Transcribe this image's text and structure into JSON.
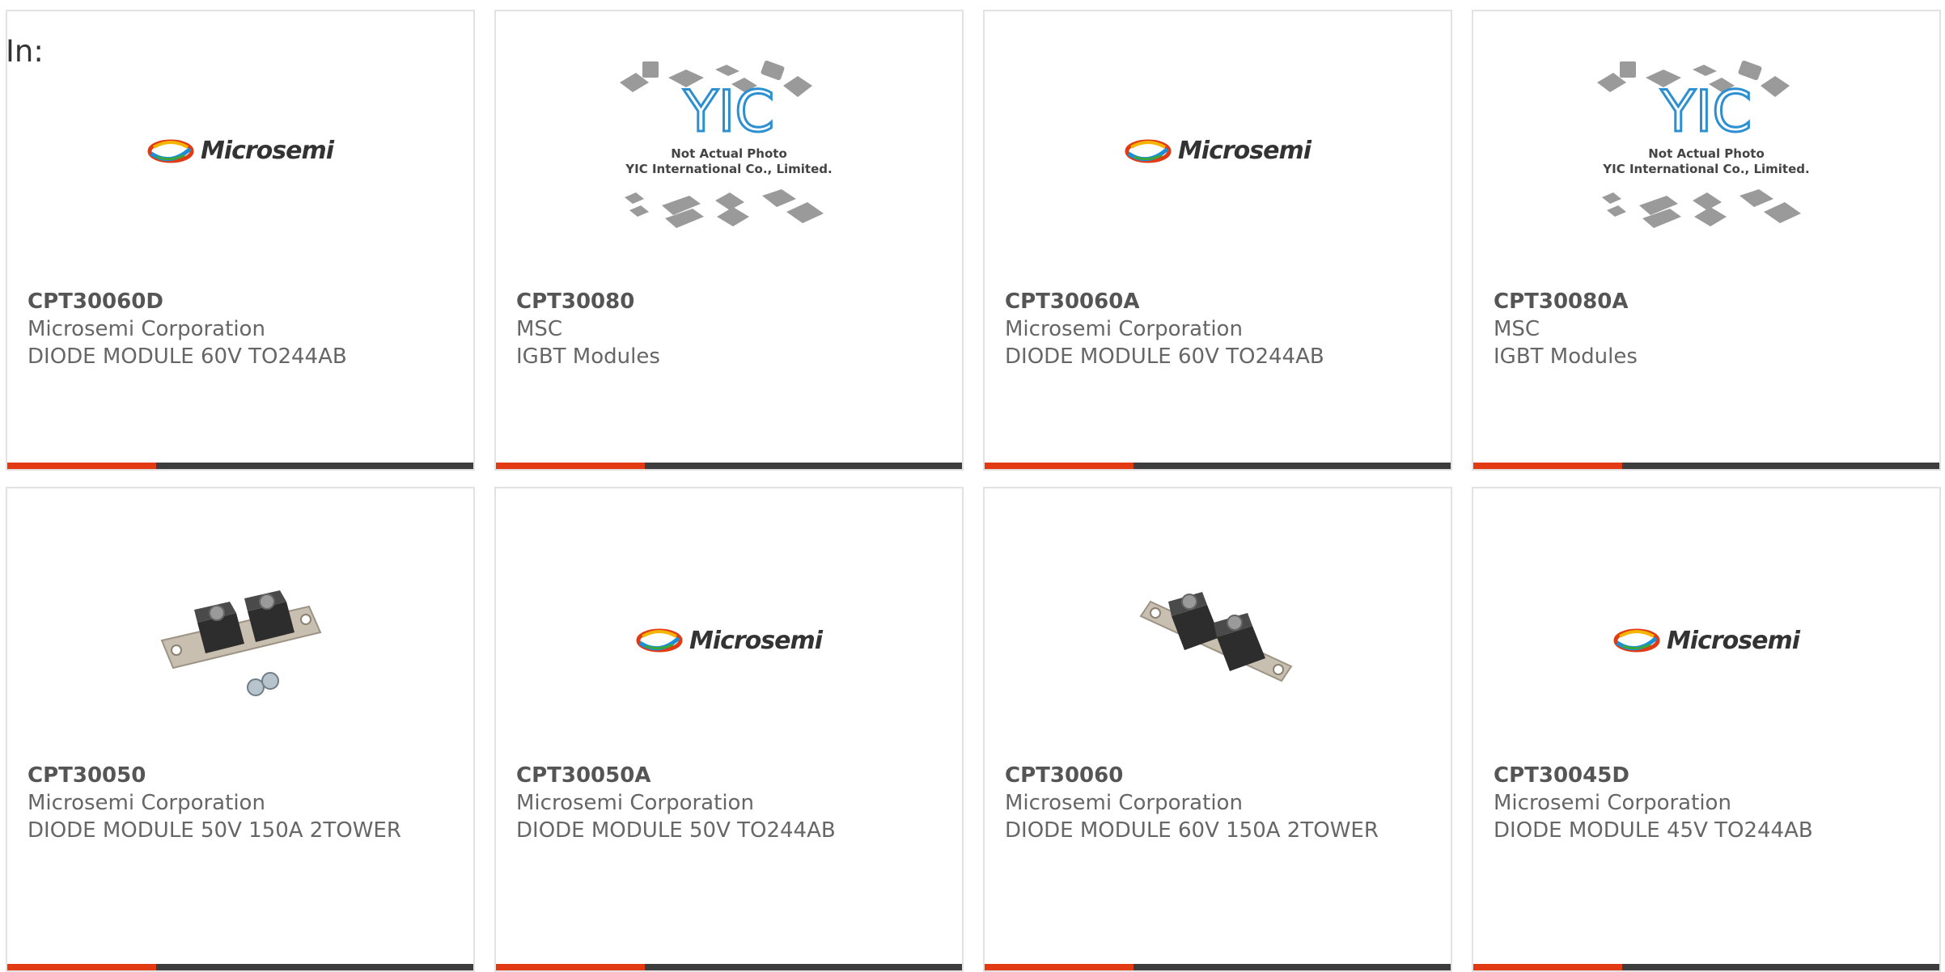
{
  "filter": {
    "label": "In:"
  },
  "products": [
    {
      "part": "CPT30060D",
      "manufacturer": "Microsemi Corporation",
      "description": "DIODE MODULE 60V TO244AB",
      "image": "microsemi-logo",
      "brand": "Microsemi"
    },
    {
      "part": "CPT30080",
      "manufacturer": "MSC",
      "description": "IGBT Modules",
      "image": "yic-placeholder",
      "placeholder_line1": "Not Actual Photo",
      "placeholder_line2": "YIC International Co., Limited."
    },
    {
      "part": "CPT30060A",
      "manufacturer": "Microsemi Corporation",
      "description": "DIODE MODULE 60V TO244AB",
      "image": "microsemi-logo",
      "brand": "Microsemi"
    },
    {
      "part": "CPT30080A",
      "manufacturer": "MSC",
      "description": "IGBT Modules",
      "image": "yic-placeholder",
      "placeholder_line1": "Not Actual Photo",
      "placeholder_line2": "YIC International Co., Limited."
    },
    {
      "part": "CPT30050",
      "manufacturer": "Microsemi Corporation",
      "description": "DIODE MODULE 50V 150A 2TOWER",
      "image": "module-photo-with-screws"
    },
    {
      "part": "CPT30050A",
      "manufacturer": "Microsemi Corporation",
      "description": "DIODE MODULE 50V TO244AB",
      "image": "microsemi-logo",
      "brand": "Microsemi"
    },
    {
      "part": "CPT30060",
      "manufacturer": "Microsemi Corporation",
      "description": "DIODE MODULE 60V 150A 2TOWER",
      "image": "module-photo"
    },
    {
      "part": "CPT30045D",
      "manufacturer": "Microsemi Corporation",
      "description": "DIODE MODULE 45V TO244AB",
      "image": "microsemi-logo",
      "brand": "Microsemi"
    }
  ],
  "colors": {
    "accent": "#e23a12",
    "bar": "#3d3d3d",
    "border": "#e2e2e2",
    "text": "#666666"
  }
}
